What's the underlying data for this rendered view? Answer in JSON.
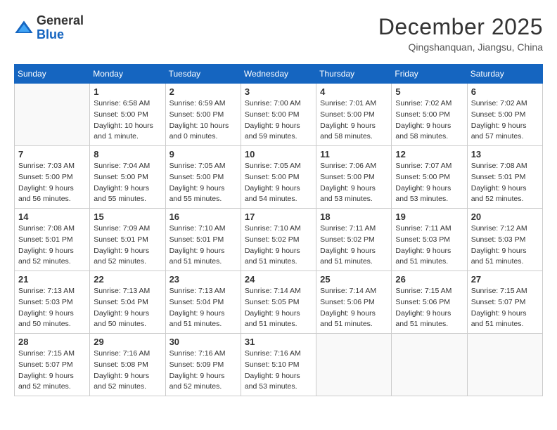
{
  "logo": {
    "general": "General",
    "blue": "Blue"
  },
  "title": "December 2025",
  "location": "Qingshanquan, Jiangsu, China",
  "weekdays": [
    "Sunday",
    "Monday",
    "Tuesday",
    "Wednesday",
    "Thursday",
    "Friday",
    "Saturday"
  ],
  "weeks": [
    [
      {
        "day": "",
        "info": ""
      },
      {
        "day": "1",
        "info": "Sunrise: 6:58 AM\nSunset: 5:00 PM\nDaylight: 10 hours\nand 1 minute."
      },
      {
        "day": "2",
        "info": "Sunrise: 6:59 AM\nSunset: 5:00 PM\nDaylight: 10 hours\nand 0 minutes."
      },
      {
        "day": "3",
        "info": "Sunrise: 7:00 AM\nSunset: 5:00 PM\nDaylight: 9 hours\nand 59 minutes."
      },
      {
        "day": "4",
        "info": "Sunrise: 7:01 AM\nSunset: 5:00 PM\nDaylight: 9 hours\nand 58 minutes."
      },
      {
        "day": "5",
        "info": "Sunrise: 7:02 AM\nSunset: 5:00 PM\nDaylight: 9 hours\nand 58 minutes."
      },
      {
        "day": "6",
        "info": "Sunrise: 7:02 AM\nSunset: 5:00 PM\nDaylight: 9 hours\nand 57 minutes."
      }
    ],
    [
      {
        "day": "7",
        "info": "Sunrise: 7:03 AM\nSunset: 5:00 PM\nDaylight: 9 hours\nand 56 minutes."
      },
      {
        "day": "8",
        "info": "Sunrise: 7:04 AM\nSunset: 5:00 PM\nDaylight: 9 hours\nand 55 minutes."
      },
      {
        "day": "9",
        "info": "Sunrise: 7:05 AM\nSunset: 5:00 PM\nDaylight: 9 hours\nand 55 minutes."
      },
      {
        "day": "10",
        "info": "Sunrise: 7:05 AM\nSunset: 5:00 PM\nDaylight: 9 hours\nand 54 minutes."
      },
      {
        "day": "11",
        "info": "Sunrise: 7:06 AM\nSunset: 5:00 PM\nDaylight: 9 hours\nand 53 minutes."
      },
      {
        "day": "12",
        "info": "Sunrise: 7:07 AM\nSunset: 5:00 PM\nDaylight: 9 hours\nand 53 minutes."
      },
      {
        "day": "13",
        "info": "Sunrise: 7:08 AM\nSunset: 5:01 PM\nDaylight: 9 hours\nand 52 minutes."
      }
    ],
    [
      {
        "day": "14",
        "info": "Sunrise: 7:08 AM\nSunset: 5:01 PM\nDaylight: 9 hours\nand 52 minutes."
      },
      {
        "day": "15",
        "info": "Sunrise: 7:09 AM\nSunset: 5:01 PM\nDaylight: 9 hours\nand 52 minutes."
      },
      {
        "day": "16",
        "info": "Sunrise: 7:10 AM\nSunset: 5:01 PM\nDaylight: 9 hours\nand 51 minutes."
      },
      {
        "day": "17",
        "info": "Sunrise: 7:10 AM\nSunset: 5:02 PM\nDaylight: 9 hours\nand 51 minutes."
      },
      {
        "day": "18",
        "info": "Sunrise: 7:11 AM\nSunset: 5:02 PM\nDaylight: 9 hours\nand 51 minutes."
      },
      {
        "day": "19",
        "info": "Sunrise: 7:11 AM\nSunset: 5:03 PM\nDaylight: 9 hours\nand 51 minutes."
      },
      {
        "day": "20",
        "info": "Sunrise: 7:12 AM\nSunset: 5:03 PM\nDaylight: 9 hours\nand 51 minutes."
      }
    ],
    [
      {
        "day": "21",
        "info": "Sunrise: 7:13 AM\nSunset: 5:03 PM\nDaylight: 9 hours\nand 50 minutes."
      },
      {
        "day": "22",
        "info": "Sunrise: 7:13 AM\nSunset: 5:04 PM\nDaylight: 9 hours\nand 50 minutes."
      },
      {
        "day": "23",
        "info": "Sunrise: 7:13 AM\nSunset: 5:04 PM\nDaylight: 9 hours\nand 51 minutes."
      },
      {
        "day": "24",
        "info": "Sunrise: 7:14 AM\nSunset: 5:05 PM\nDaylight: 9 hours\nand 51 minutes."
      },
      {
        "day": "25",
        "info": "Sunrise: 7:14 AM\nSunset: 5:06 PM\nDaylight: 9 hours\nand 51 minutes."
      },
      {
        "day": "26",
        "info": "Sunrise: 7:15 AM\nSunset: 5:06 PM\nDaylight: 9 hours\nand 51 minutes."
      },
      {
        "day": "27",
        "info": "Sunrise: 7:15 AM\nSunset: 5:07 PM\nDaylight: 9 hours\nand 51 minutes."
      }
    ],
    [
      {
        "day": "28",
        "info": "Sunrise: 7:15 AM\nSunset: 5:07 PM\nDaylight: 9 hours\nand 52 minutes."
      },
      {
        "day": "29",
        "info": "Sunrise: 7:16 AM\nSunset: 5:08 PM\nDaylight: 9 hours\nand 52 minutes."
      },
      {
        "day": "30",
        "info": "Sunrise: 7:16 AM\nSunset: 5:09 PM\nDaylight: 9 hours\nand 52 minutes."
      },
      {
        "day": "31",
        "info": "Sunrise: 7:16 AM\nSunset: 5:10 PM\nDaylight: 9 hours\nand 53 minutes."
      },
      {
        "day": "",
        "info": ""
      },
      {
        "day": "",
        "info": ""
      },
      {
        "day": "",
        "info": ""
      }
    ]
  ]
}
